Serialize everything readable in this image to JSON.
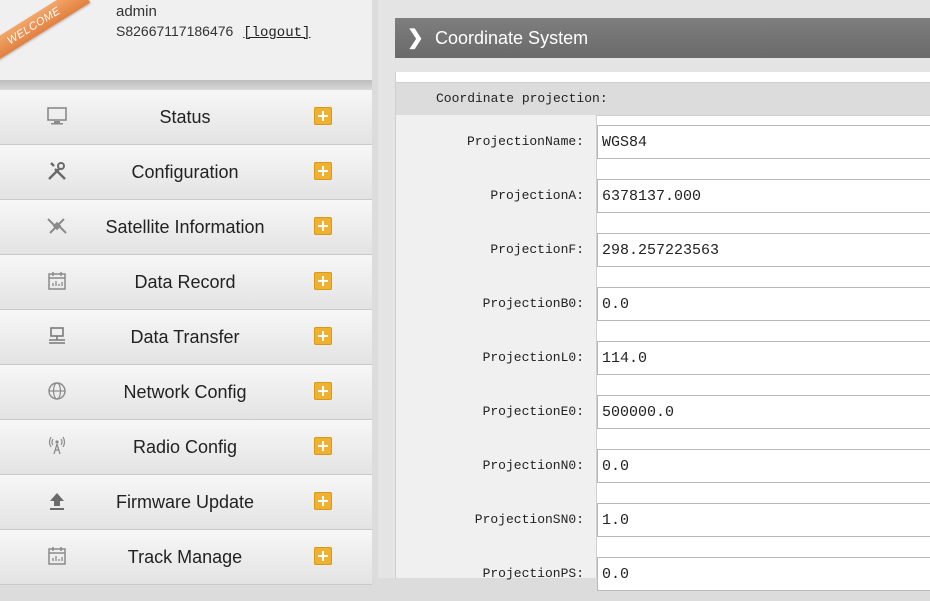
{
  "user": {
    "welcome": "WELCOME",
    "name": "admin",
    "serial": "S82667117186476",
    "logout": "[logout]"
  },
  "menu": [
    {
      "label": "Status",
      "icon": "monitor-icon"
    },
    {
      "label": "Configuration",
      "icon": "tools-icon"
    },
    {
      "label": "Satellite Information",
      "icon": "satellite-icon"
    },
    {
      "label": "Data Record",
      "icon": "calendar-icon"
    },
    {
      "label": "Data Transfer",
      "icon": "network-computer-icon"
    },
    {
      "label": "Network Config",
      "icon": "globe-icon"
    },
    {
      "label": "Radio Config",
      "icon": "antenna-icon"
    },
    {
      "label": "Firmware Update",
      "icon": "upload-icon"
    },
    {
      "label": "Track Manage",
      "icon": "calendar-icon"
    }
  ],
  "colors": {
    "plus_badge": "#f0b030",
    "header_bg": "#737373",
    "welcome_ribbon": "#e8884a"
  },
  "section": {
    "title": "Coordinate System",
    "subheader": "Coordinate projection:"
  },
  "fields": [
    {
      "label": "ProjectionName:",
      "value": "WGS84"
    },
    {
      "label": "ProjectionA:",
      "value": "6378137.000"
    },
    {
      "label": "ProjectionF:",
      "value": "298.257223563"
    },
    {
      "label": "ProjectionB0:",
      "value": "0.0"
    },
    {
      "label": "ProjectionL0:",
      "value": "114.0"
    },
    {
      "label": "ProjectionE0:",
      "value": "500000.0"
    },
    {
      "label": "ProjectionN0:",
      "value": "0.0"
    },
    {
      "label": "ProjectionSN0:",
      "value": "1.0"
    },
    {
      "label": "ProjectionPS:",
      "value": "0.0"
    }
  ]
}
